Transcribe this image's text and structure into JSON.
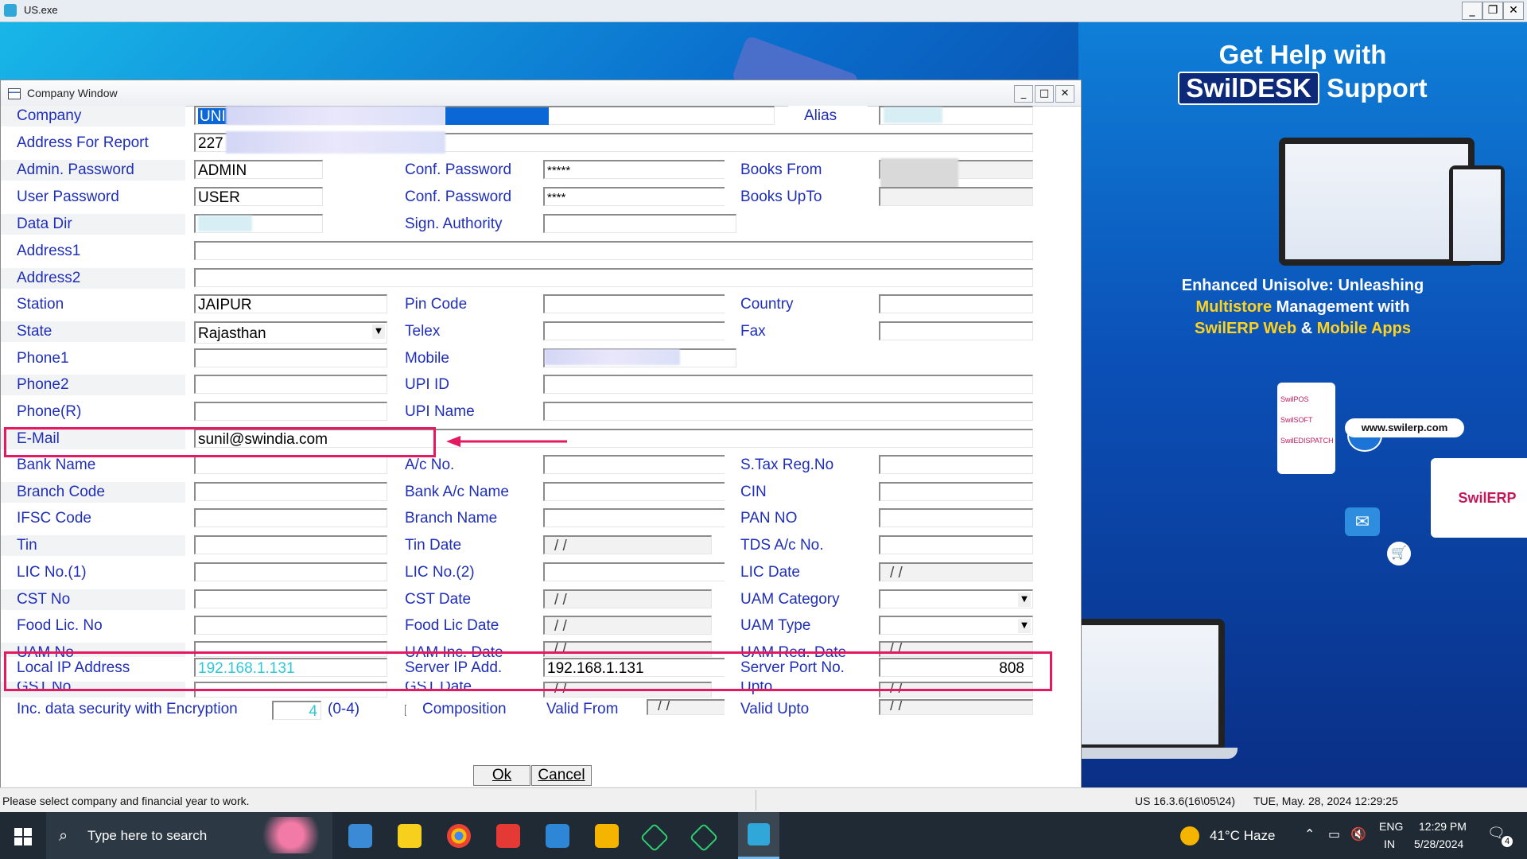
{
  "app": {
    "title": "US.exe"
  },
  "promo": {
    "heading_line1": "Get Help with",
    "heading_brand": "SwilDESK",
    "heading_suffix": "Support",
    "para_line1": "Enhanced Unisolve: Unleashing",
    "para_line2a": "Multistore",
    "para_line2b": " Management with",
    "para_line3a": "SwilERP Web",
    "para_line3b": " & ",
    "para_line3c": "Mobile Apps",
    "website": "www.swilerp.com",
    "brand_badge": "SwilERP",
    "apps": [
      "SwilPOS",
      "SwilSOFT",
      "SwilEDISPATCH"
    ]
  },
  "window": {
    "title": "Company Window",
    "labels": {
      "company": "Company",
      "alias": "Alias",
      "address_report": "Address For Report",
      "admin_password": "Admin.  Password",
      "conf_password": "Conf. Password",
      "books_from": "Books From",
      "user_password": "User Password",
      "books_upto": "Books UpTo",
      "data_dir": "Data Dir",
      "sign_authority": "Sign. Authority",
      "address1": "Address1",
      "address2": "Address2",
      "station": "Station",
      "pin_code": "Pin Code",
      "country": "Country",
      "state": "State",
      "telex": "Telex",
      "fax": "Fax",
      "phone1": "Phone1",
      "mobile": "Mobile",
      "phone2": "Phone2",
      "upi_id": "UPI ID",
      "phone_r": "Phone(R)",
      "upi_name": "UPI Name",
      "email": "E-Mail",
      "bank_name": "Bank Name",
      "ac_no": "A/c No.",
      "stax_reg": "S.Tax Reg.No",
      "branch_code": "Branch Code",
      "bank_ac_name": "Bank A/c Name",
      "cin": "CIN",
      "ifsc": "IFSC Code",
      "branch_name": "Branch Name",
      "pan_no": "PAN NO",
      "tin": "Tin",
      "tin_date": "Tin Date",
      "tds_ac": "TDS A/c No.",
      "lic1": "LIC No.(1)",
      "lic2": "LIC No.(2)",
      "lic_date": "LIC Date",
      "cst_no": "CST No",
      "cst_date": "CST Date",
      "uam_category": "UAM Category",
      "food_lic": "Food Lic. No",
      "food_lic_date": "Food Lic Date",
      "uam_type": "UAM Type",
      "uam_no": "UAM No",
      "uam_inc_date": "UAM Inc. Date",
      "uam_reg_date": "UAM Reg. Date",
      "local_ip": "Local IP Address",
      "server_ip": "Server IP Add.",
      "server_port": "Server Port No.",
      "gst_no": "GST No",
      "gst_date": "GST Date",
      "upto": "Upto",
      "encryption": "Inc. data security with Encryption",
      "enc_range": "(0-4)",
      "composition": "Composition",
      "valid_from": "Valid From",
      "valid_upto": "Valid Upto"
    },
    "values": {
      "company": "UNI",
      "address_report": "227",
      "admin_password": "ADMIN",
      "conf_password1": "*****",
      "user_password": "USER",
      "conf_password2": "****",
      "station": "JAIPUR",
      "state": "Rajasthan",
      "email": "sunil@swindia.com",
      "date_blank": "/ /",
      "local_ip": "192.168.1.131",
      "server_ip": "192.168.1.131",
      "server_port": "808",
      "encryption": "4"
    },
    "buttons": {
      "ok": "Ok",
      "cancel": "Cancel"
    }
  },
  "statusbar": {
    "message": "Please select company and financial year to work.",
    "version": "US 16.3.6(16\\05\\24)",
    "datetime": "TUE, May. 28, 2024  12:29:25"
  },
  "taskbar": {
    "search_placeholder": "Type here to search",
    "weather": "41°C  Haze",
    "lang1": "ENG",
    "lang2": "IN",
    "time": "12:29 PM",
    "date": "5/28/2024",
    "notifications": "4"
  },
  "colors": {
    "label_blue": "#1f2fb8",
    "highlight": "#e5195f",
    "cyan_text": "#2fc7d8"
  }
}
